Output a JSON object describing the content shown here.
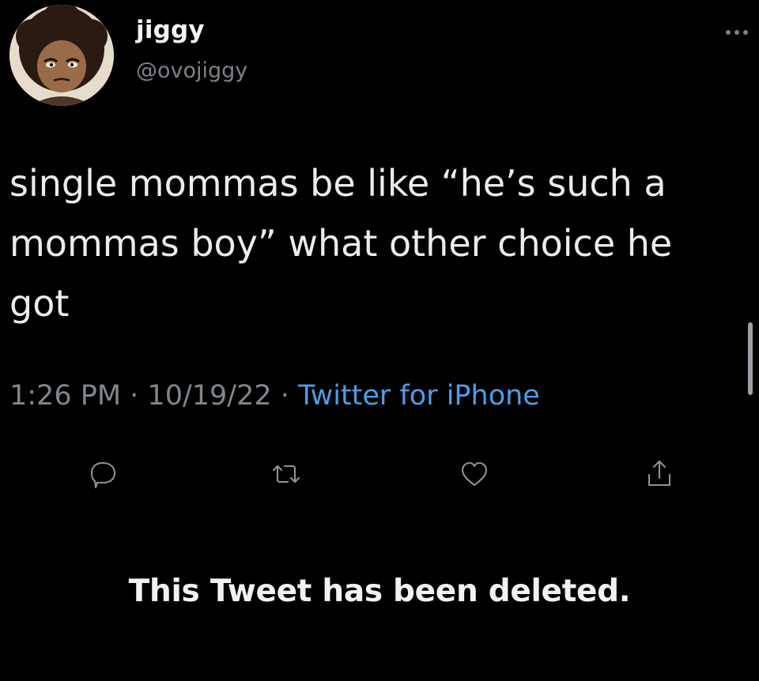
{
  "author": {
    "name": "jiggy",
    "handle": "@ovojiggy"
  },
  "tweet": {
    "text": "single mommas be like “he’s such a\nmommas boy” what other choice he\ngot"
  },
  "meta": {
    "time": "1:26 PM",
    "separator1": " · ",
    "date": "10/19/22",
    "separator2": " · ",
    "source": "Twitter for iPhone"
  },
  "icons": {
    "more": "more-options-icon",
    "reply": "reply-icon",
    "retweet": "retweet-icon",
    "like": "heart-icon",
    "share": "share-icon"
  },
  "notice": {
    "deleted": "This Tweet has been deleted."
  },
  "colors": {
    "background": "#000000",
    "text": "#e7e9ea",
    "muted": "#7f868c",
    "link": "#4a9ee7"
  }
}
